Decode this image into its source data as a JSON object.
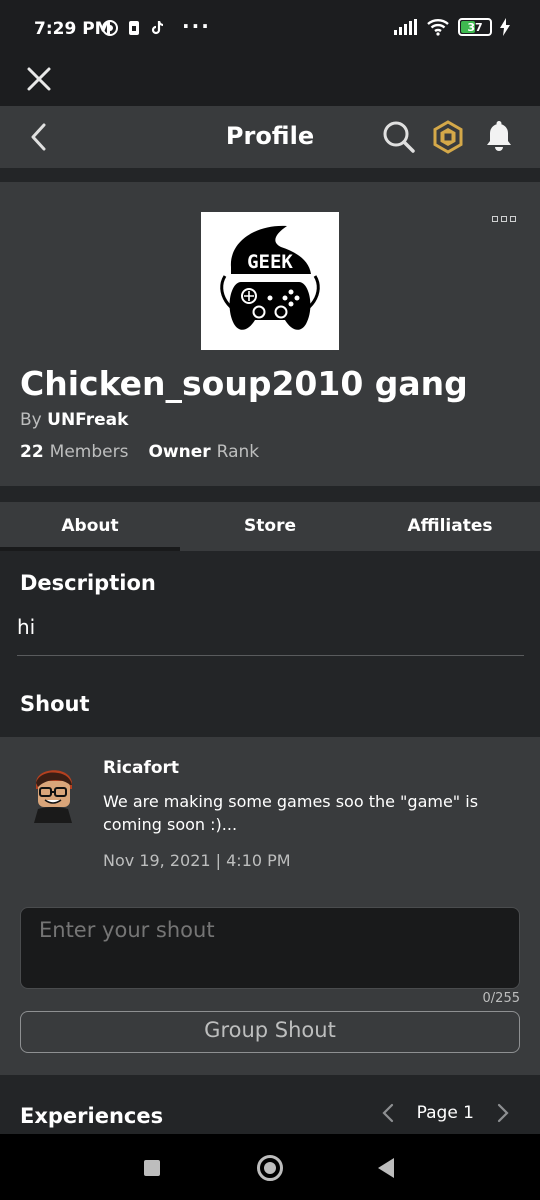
{
  "status_bar": {
    "time": "7:29 PM",
    "more": "···",
    "battery": "37"
  },
  "nav": {
    "title": "Profile"
  },
  "group": {
    "logo_text": "GEEK",
    "name": "Chicken_soup2010 gang",
    "by_label": "By",
    "owner": "UNFreak",
    "members_count": "22",
    "members_label": "Members",
    "rank_value": "Owner",
    "rank_label": "Rank"
  },
  "tabs": [
    {
      "label": "About",
      "active": true
    },
    {
      "label": "Store",
      "active": false
    },
    {
      "label": "Affiliates",
      "active": false
    }
  ],
  "description": {
    "title": "Description",
    "text": "hi"
  },
  "shout": {
    "title": "Shout",
    "user": "Ricafort",
    "body": "We are making some games soo the \"game\" is coming soon :)...",
    "date": "Nov 19, 2021 | 4:10 PM",
    "input_placeholder": "Enter your shout",
    "counter": "0/255",
    "button_label": "Group Shout"
  },
  "experiences": {
    "title": "Experiences",
    "page_label": "Page 1"
  },
  "colors": {
    "page_bg": "#232527",
    "card_bg": "#393b3d",
    "robux_gold": "#d4a849"
  },
  "icons": [
    "close-icon",
    "back-icon",
    "search-icon",
    "robux-icon",
    "bell-icon",
    "more-icon",
    "chevron-left-icon",
    "chevron-right-icon"
  ]
}
